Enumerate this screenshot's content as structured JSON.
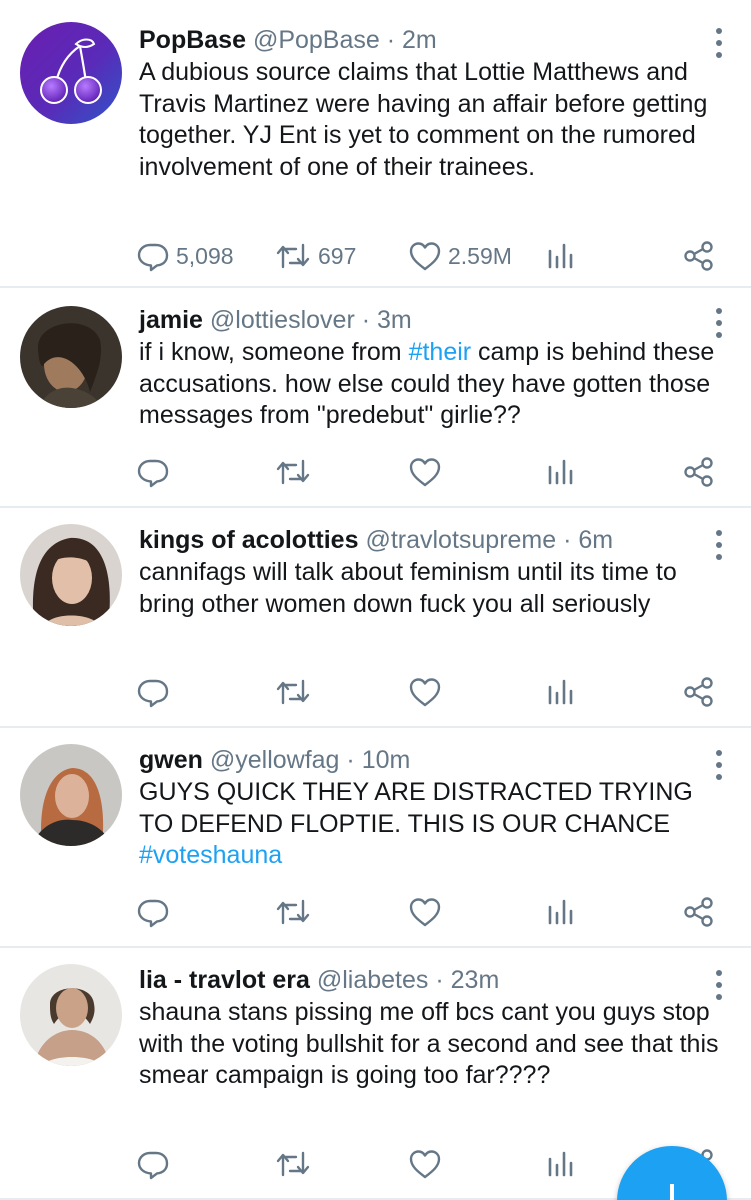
{
  "tweets": [
    {
      "name": "PopBase",
      "handle": "@PopBase",
      "sep": " · ",
      "time": "2m",
      "text": [
        {
          "t": "A dubious source claims that Lottie Matthews and Travis Martinez were having an affair before getting together. YJ Ent is yet to comment on the rumored involvement of one of their trainees."
        }
      ],
      "replies": "5,098",
      "retweets": "697",
      "likes": "2.59M"
    },
    {
      "name": "jamie",
      "handle": "@lottieslover",
      "sep": " · ",
      "time": "3m",
      "text": [
        {
          "t": "if i know, someone from "
        },
        {
          "t": "#their",
          "tag": true
        },
        {
          "t": " camp is behind these accusations. how else could they have gotten those messages from \"predebut\" girlie??"
        }
      ],
      "replies": "",
      "retweets": "",
      "likes": ""
    },
    {
      "name": "kings of acolotties",
      "handle": "@travlotsupreme",
      "sep": " · ",
      "time": "6m",
      "text": [
        {
          "t": "cannifags will talk about feminism until its time to bring other women down fuck you all seriously"
        }
      ],
      "replies": "",
      "retweets": "",
      "likes": ""
    },
    {
      "name": "gwen",
      "handle": "@yellowfag",
      "sep": " · ",
      "time": "10m",
      "text": [
        {
          "t": "GUYS QUICK THEY ARE DISTRACTED TRYING TO DEFEND FLOPTIE. THIS IS OUR CHANCE "
        },
        {
          "t": "#voteshauna",
          "tag": true
        }
      ],
      "replies": "",
      "retweets": "",
      "likes": ""
    },
    {
      "name": "lia - travlot era",
      "handle": "@liabetes",
      "sep": " · ",
      "time": "23m",
      "text": [
        {
          "t": "shauna stans pissing me off bcs cant you guys stop with the voting bullshit for a second and see that this smear campaign is going too far????"
        }
      ],
      "replies": "",
      "retweets": "",
      "likes": ""
    }
  ],
  "icons": {
    "reply": "reply-icon",
    "retweet": "retweet-icon",
    "like": "heart-icon",
    "stats": "analytics-icon",
    "share": "share-icon",
    "more": "more-vertical-icon",
    "fab": "compose-plus-icon"
  },
  "colors": {
    "accent": "#1da1f2",
    "text": "#14171a",
    "secondary": "#657786",
    "divider": "#e6ecf0"
  }
}
